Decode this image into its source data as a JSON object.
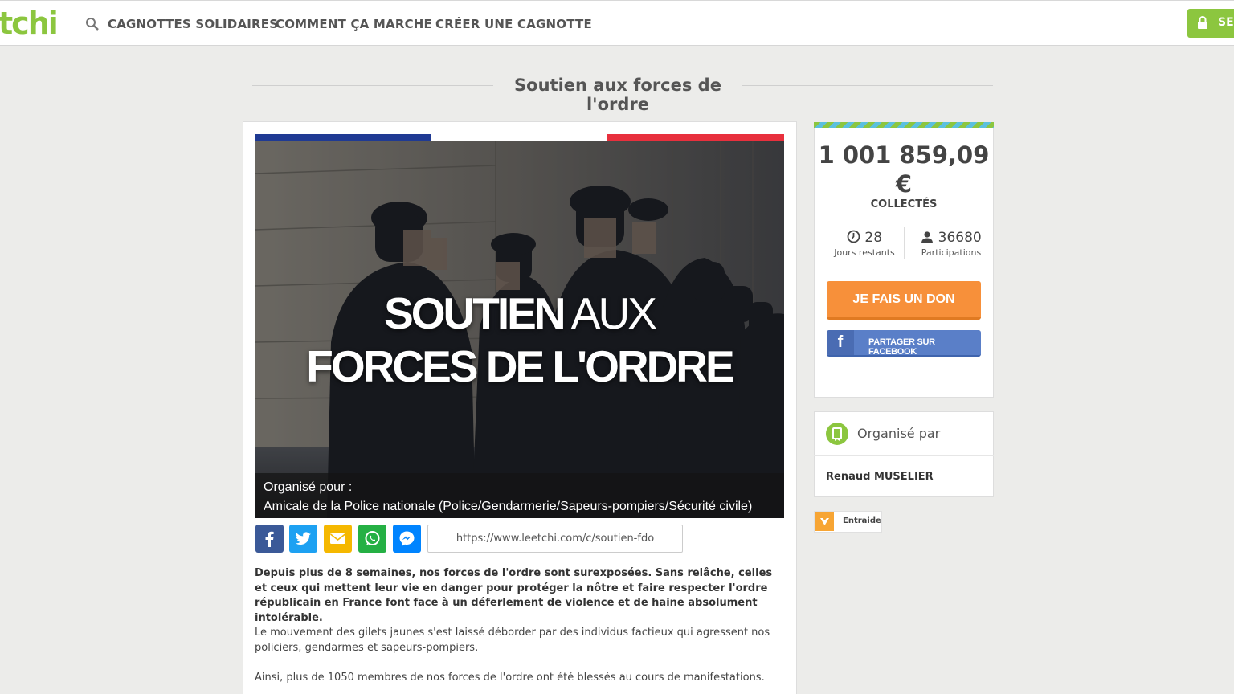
{
  "header": {
    "logo_text": "tchi",
    "nav": [
      "CAGNOTTES SOLIDAIRES",
      "COMMENT ÇA MARCHE",
      "CRÉER UNE CAGNOTTE"
    ],
    "login_label": "SE",
    "accent_color": "#8cc63f"
  },
  "page": {
    "title": "Soutien aux forces de l'ordre"
  },
  "hero": {
    "title_bold_1": "SOUTIEN",
    "title_light_1": " AUX",
    "title_line_2": "FORCES DE L'ORDRE",
    "organized_for_label": "Organisé pour :",
    "organized_for_value": "Amicale de la Police nationale (Police/Gendarmerie/Sapeurs-pompiers/Sécurité civile)",
    "flag_colors": [
      "#1f3a93",
      "#ffffff",
      "#e8303d"
    ]
  },
  "share": {
    "icons": [
      "facebook-icon",
      "twitter-icon",
      "email-icon",
      "whatsapp-icon",
      "messenger-icon"
    ],
    "url": "https://www.leetchi.com/c/soutien-fdo"
  },
  "description": {
    "p1": "Depuis plus de 8 semaines, nos forces de l'ordre sont surexposées. Sans relâche, celles et ceux qui mettent leur vie en danger pour protéger la nôtre et faire respecter l'ordre républicain en France font face à un déferlement de violence et de haine absolument intolérable.",
    "p2": "Le mouvement des gilets jaunes s'est laissé déborder par des individus factieux qui agressent nos policiers, gendarmes et sapeurs-pompiers.",
    "p3": "Ainsi, plus de 1050 membres de nos forces de l'ordre ont été blessés au cours de manifestations."
  },
  "stats": {
    "amount": "1 001 859,09",
    "currency": "€",
    "collected_label": "COLLECTÉS",
    "days_left": "28",
    "days_left_label": "Jours restants",
    "participants": "36680",
    "participants_label": "Participations"
  },
  "actions": {
    "donate_label": "JE FAIS UN DON",
    "facebook_share_label": "PARTAGER SUR FACEBOOK",
    "donate_color": "#f7903a",
    "facebook_color": "#5a7fc8"
  },
  "organizer": {
    "label": "Organisé par",
    "name": "Renaud MUSELIER"
  },
  "category": {
    "label": "Entraide"
  }
}
